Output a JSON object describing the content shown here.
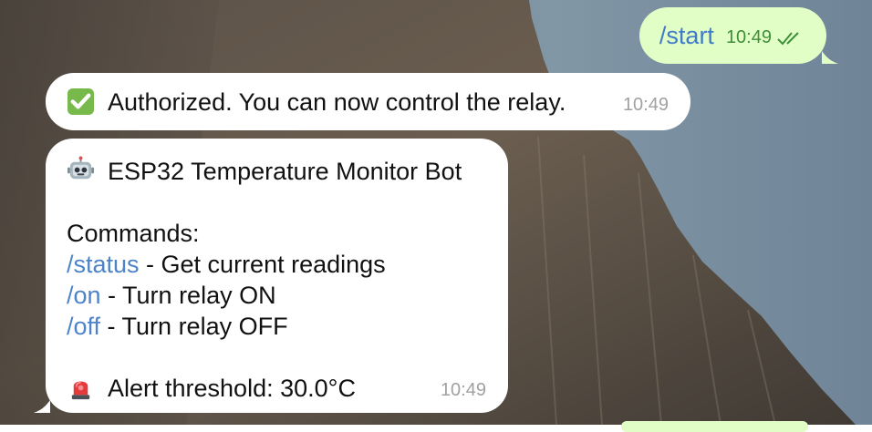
{
  "messages": {
    "outgoing": {
      "text": "/start",
      "time": "10:49"
    },
    "authorized": {
      "text": "Authorized. You can now control the relay.",
      "time": "10:49"
    },
    "bot_info": {
      "title": "ESP32 Temperature Monitor Bot",
      "commands_heading": "Commands:",
      "commands": [
        {
          "command": "/status",
          "description": " - Get current readings"
        },
        {
          "command": "/on",
          "description": " - Turn relay ON"
        },
        {
          "command": "/off",
          "description": " - Turn relay OFF"
        }
      ],
      "alert": "Alert threshold: 30.0°C",
      "time": "10:49"
    }
  },
  "icons": {
    "authorized": "white-heavy-check-mark-icon",
    "bot": "robot-face-icon",
    "alert": "police-car-light-icon",
    "sent_status": "double-check-icon"
  },
  "colors": {
    "outgoing_bubble": "#e2fec7",
    "incoming_bubble": "#ffffff",
    "command_link": "#4d84c7",
    "outgoing_time": "#3e8f37",
    "incoming_time": "#a1a1a1"
  }
}
